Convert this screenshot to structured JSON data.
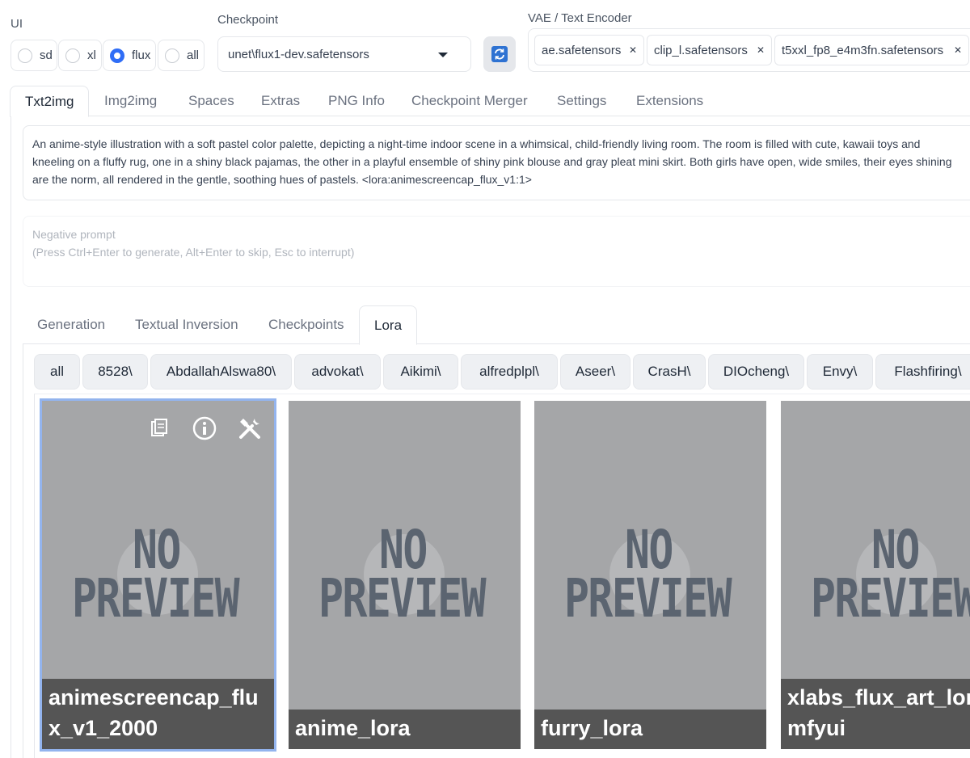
{
  "ui_group": {
    "label": "UI",
    "options": [
      "sd",
      "xl",
      "flux",
      "all"
    ],
    "selected": "flux"
  },
  "checkpoint": {
    "label": "Checkpoint",
    "value": "unet\\flux1-dev.safetensors"
  },
  "vae": {
    "label": "VAE / Text Encoder",
    "chips": [
      "ae.safetensors",
      "clip_l.safetensors",
      "t5xxl_fp8_e4m3fn.safetensors"
    ]
  },
  "main_tabs": [
    "Txt2img",
    "Img2img",
    "Spaces",
    "Extras",
    "PNG Info",
    "Checkpoint Merger",
    "Settings",
    "Extensions"
  ],
  "prompt": {
    "lines": [
      "An anime-style illustration with a soft pastel color palette, depicting a night-time indoor scene in a whimsical, child-friendly living room. The room is filled with cute, kawaii toys and",
      "kneeling on a fluffy rug, one in a shiny black pajamas, the other in a playful ensemble of shiny pink blouse and gray pleat mini skirt. Both girls have open, wide smiles, their eyes shining",
      "are the norm, all rendered in the gentle, soothing hues of pastels.  <lora:animescreencap_flux_v1:1>"
    ]
  },
  "negative_prompt": {
    "line1": "Negative prompt",
    "line2": "(Press Ctrl+Enter to generate, Alt+Enter to skip, Esc to interrupt)"
  },
  "sub_tabs": [
    "Generation",
    "Textual Inversion",
    "Checkpoints",
    "Lora"
  ],
  "filters": [
    "all",
    "8528\\",
    "AbdallahAlswa80\\",
    "advokat\\",
    "Aikimi\\",
    "alfredplpl\\",
    "Aseer\\",
    "CrasH\\",
    "DIOcheng\\",
    "Envy\\",
    "Flashfiring\\"
  ],
  "cards": [
    {
      "name": "animescreencap_flux_v1_2000",
      "preview_line1": "NO",
      "preview_line2": "PREVIEW"
    },
    {
      "name": "anime_lora",
      "preview_line1": "NO",
      "preview_line2": "PREVIEW"
    },
    {
      "name": "furry_lora",
      "preview_line1": "NO",
      "preview_line2": "PREVIEW"
    },
    {
      "name": "xlabs_flux_art_lora_mfyui",
      "preview_line1": "NO",
      "preview_line2": "PREVIEW"
    }
  ],
  "card_icons": [
    "copy-icon",
    "info-icon",
    "tools-icon"
  ],
  "colors": {
    "accent": "#2f6df6",
    "card_bg": "#a5a6a8",
    "card_label_bg": "#555555",
    "selected_outline": "#93b4ee"
  }
}
